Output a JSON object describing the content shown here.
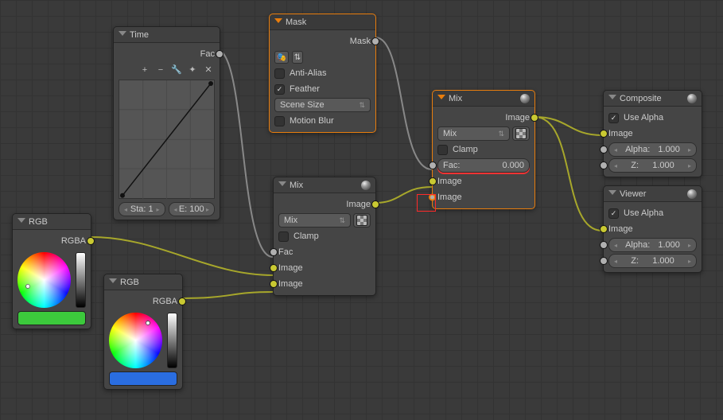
{
  "nodes": {
    "time": {
      "title": "Time",
      "fac": "Fac",
      "sta_label": "Sta:",
      "sta_val": "1",
      "end_label": "E:",
      "end_val": "100"
    },
    "mask": {
      "title": "Mask",
      "out": "Mask",
      "anti_alias": "Anti-Alias",
      "feather": "Feather",
      "scene_size": "Scene Size",
      "motion_blur": "Motion Blur"
    },
    "rgb1": {
      "title": "RGB",
      "out": "RGBA",
      "swatch": "#3cc93c"
    },
    "rgb2": {
      "title": "RGB",
      "out": "RGBA",
      "swatch": "#2a6de0"
    },
    "mix1": {
      "title": "Mix",
      "out": "Image",
      "mode": "Mix",
      "clamp": "Clamp",
      "fac": "Fac",
      "image": "Image"
    },
    "mix2": {
      "title": "Mix",
      "out": "Image",
      "mode": "Mix",
      "clamp": "Clamp",
      "fac_label": "Fac:",
      "fac_val": "0.000",
      "image": "Image"
    },
    "composite": {
      "title": "Composite",
      "use_alpha": "Use Alpha",
      "image": "Image",
      "alpha_label": "Alpha:",
      "alpha_val": "1.000",
      "z_label": "Z:",
      "z_val": "1.000"
    },
    "viewer": {
      "title": "Viewer",
      "use_alpha": "Use Alpha",
      "image": "Image",
      "alpha_label": "Alpha:",
      "alpha_val": "1.000",
      "z_label": "Z:",
      "z_val": "1.000"
    }
  }
}
